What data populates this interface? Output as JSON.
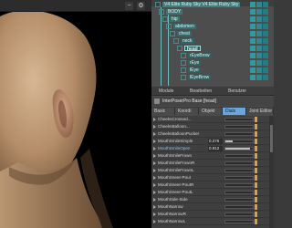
{
  "viewport": {
    "toolbar_minus": "−",
    "toolbar_gear": "⚙"
  },
  "scene_tree": {
    "items": [
      {
        "label": "V4 Elite Ruby Sky V4 Elite Ruby Sky",
        "level": 0
      },
      {
        "label": "BODY",
        "level": 1
      },
      {
        "label": "hip",
        "level": 2
      },
      {
        "label": "abdomen",
        "level": 3
      },
      {
        "label": "chest",
        "level": 4
      },
      {
        "label": "neck",
        "level": 5
      },
      {
        "label": "head",
        "level": 6,
        "selected": true
      },
      {
        "label": "rEyeBrow",
        "level": 7
      },
      {
        "label": "rEye",
        "level": 7
      },
      {
        "label": "lEye",
        "level": 7
      },
      {
        "label": "lEyeBrow",
        "level": 7
      }
    ]
  },
  "tabs_top": [
    "Module",
    "Bearbeiten",
    "Benutzer"
  ],
  "breadcrumb": "InterPoserPro Base [head]",
  "tabs_params": [
    {
      "label": "Basic",
      "active": false
    },
    {
      "label": "Koordi",
      "active": false
    },
    {
      "label": "Objekt",
      "active": false
    },
    {
      "label": "Dials",
      "active": true
    },
    {
      "label": "Joint Editor",
      "active": false
    }
  ],
  "morphs": [
    {
      "name": "CheeksCrossed...",
      "value": "",
      "fill": 0.0,
      "selected": false
    },
    {
      "name": "CheeksBalloon...",
      "value": "",
      "fill": 0.0,
      "selected": false
    },
    {
      "name": "CheeksBalloonPucker",
      "value": "",
      "fill": 0.0,
      "selected": false
    },
    {
      "name": "MouthSmileSimple",
      "value": "0.276",
      "fill": 0.28,
      "selected": false
    },
    {
      "name": "MouthSmileOpen",
      "value": "0.912",
      "fill": 0.91,
      "selected": true
    },
    {
      "name": "MouthSmileFrown",
      "value": "",
      "fill": 0.0,
      "selected": false
    },
    {
      "name": "MouthSmileFrownR",
      "value": "",
      "fill": 0.0,
      "selected": false
    },
    {
      "name": "MouthSmileFrownL",
      "value": "",
      "fill": 0.0,
      "selected": false
    },
    {
      "name": "MouthSneer-Pout",
      "value": "",
      "fill": 0.0,
      "selected": false
    },
    {
      "name": "MouthSneer-PoutR",
      "value": "",
      "fill": 0.0,
      "selected": false
    },
    {
      "name": "MouthSneer-PoutL",
      "value": "",
      "fill": 0.0,
      "selected": false
    },
    {
      "name": "MouthSide-Side",
      "value": "",
      "fill": 0.0,
      "selected": false
    },
    {
      "name": "MouthNarrow",
      "value": "",
      "fill": 0.0,
      "selected": false
    },
    {
      "name": "MouthNarrowR",
      "value": "",
      "fill": 0.0,
      "selected": false
    },
    {
      "name": "MouthNarrowL",
      "value": "",
      "fill": 0.0,
      "selected": false
    }
  ]
}
